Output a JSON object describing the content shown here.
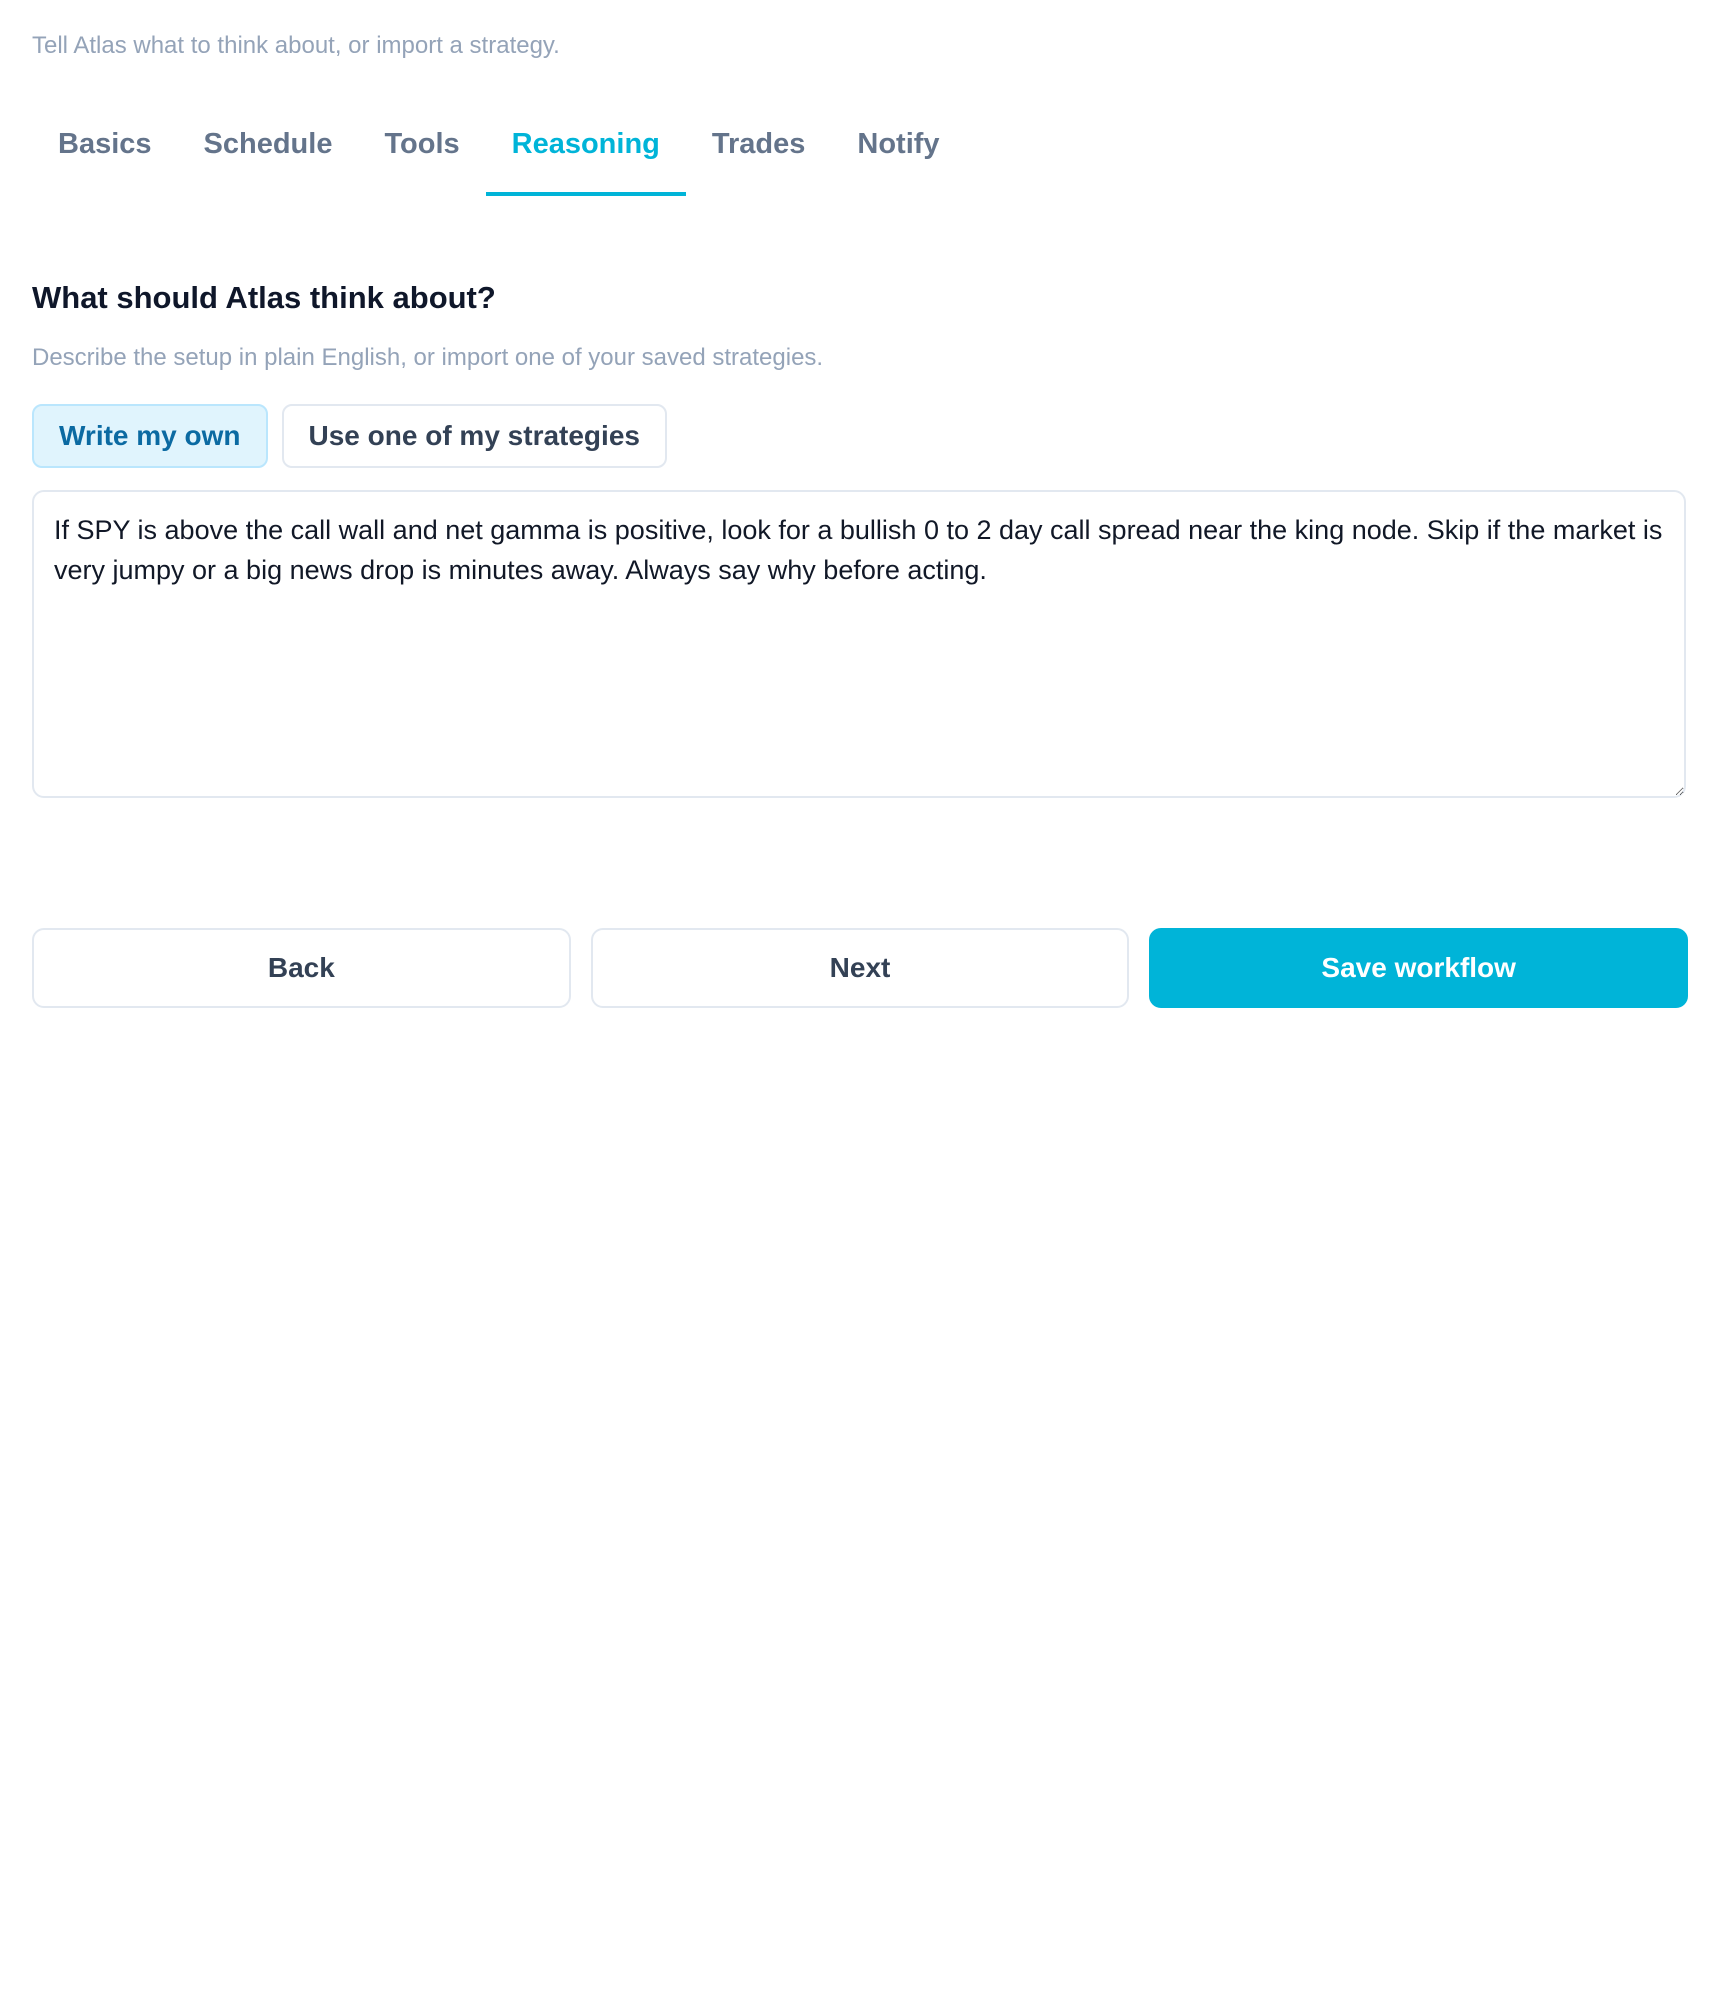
{
  "header": {
    "subtitle": "Tell Atlas what to think about, or import a strategy."
  },
  "tabs": [
    {
      "label": "Basics",
      "active": false
    },
    {
      "label": "Schedule",
      "active": false
    },
    {
      "label": "Tools",
      "active": false
    },
    {
      "label": "Reasoning",
      "active": true
    },
    {
      "label": "Trades",
      "active": false
    },
    {
      "label": "Notify",
      "active": false
    }
  ],
  "reasoning": {
    "title": "What should Atlas think about?",
    "description": "Describe the setup in plain English, or import one of your saved strategies.",
    "modes": [
      {
        "label": "Write my own",
        "selected": true
      },
      {
        "label": "Use one of my strategies",
        "selected": false
      }
    ],
    "prompt_value": "If SPY is above the call wall and net gamma is positive, look for a bullish 0 to 2 day call spread near the king node. Skip if the market is very jumpy or a big news drop is minutes away. Always say why before acting."
  },
  "actions": {
    "back_label": "Back",
    "next_label": "Next",
    "save_label": "Save workflow"
  },
  "colors": {
    "accent": "#00b4d8",
    "muted_text": "#94a3b8",
    "tab_text": "#64748b",
    "selected_mode_bg": "#e0f4fd"
  }
}
